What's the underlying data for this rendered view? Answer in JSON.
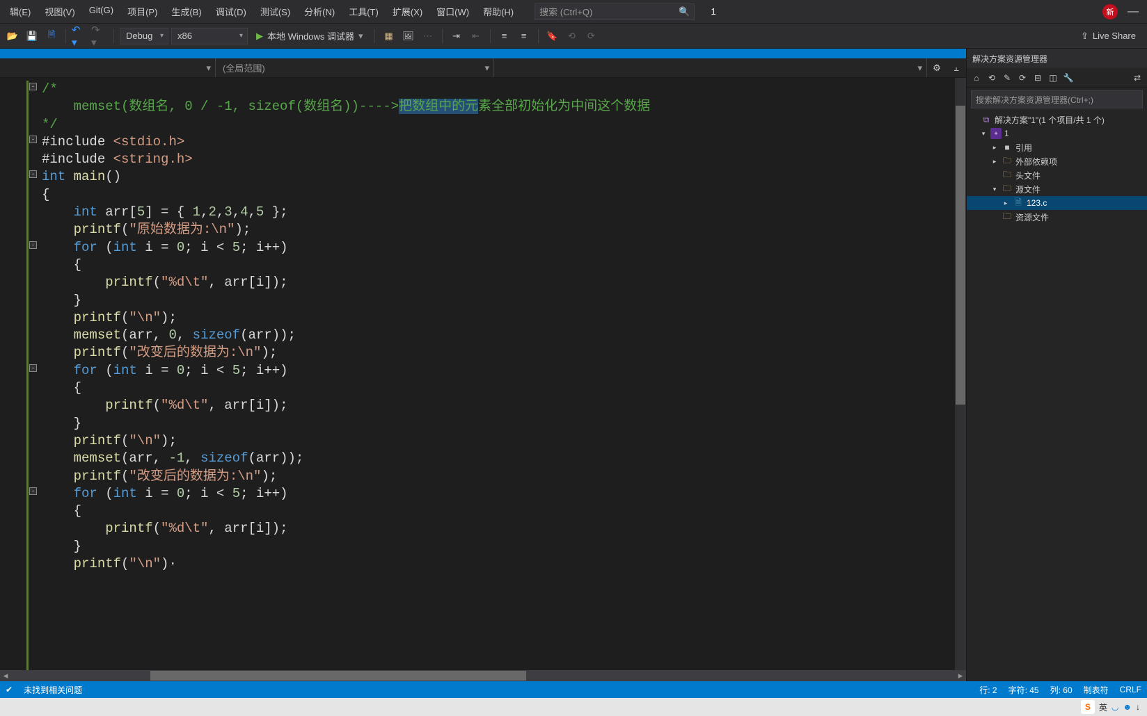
{
  "menubar": {
    "items": [
      "辑(E)",
      "视图(V)",
      "Git(G)",
      "项目(P)",
      "生成(B)",
      "调试(D)",
      "测试(S)",
      "分析(N)",
      "工具(T)",
      "扩展(X)",
      "窗口(W)",
      "帮助(H)"
    ],
    "search_placeholder": "搜索 (Ctrl+Q)",
    "tab_badge": "1",
    "new_badge": "新"
  },
  "toolbar": {
    "config": "Debug",
    "platform": "x86",
    "run_label": "本地 Windows 调试器",
    "live_share": "Live Share"
  },
  "editor": {
    "scope_combo": "(全局范围)",
    "code_lines": [
      {
        "indent": 0,
        "fold": "-",
        "tokens": [
          {
            "t": "c-comment",
            "v": "/*"
          }
        ]
      },
      {
        "indent": 2,
        "tokens": [
          {
            "t": "c-comment",
            "v": "memset(数组名, 0 / -1, sizeof(数组名))---->"
          },
          {
            "t": "c-comment sel-highlight",
            "v": "把数组中的元"
          },
          {
            "t": "c-comment",
            "v": "素全部初始化为中间这个数据"
          }
        ]
      },
      {
        "indent": 0,
        "tokens": [
          {
            "t": "c-comment",
            "v": "*/"
          }
        ]
      },
      {
        "indent": 0,
        "fold": "-",
        "tokens": [
          {
            "t": "c-default",
            "v": "#include "
          },
          {
            "t": "c-string",
            "v": "<stdio.h>"
          }
        ]
      },
      {
        "indent": 0,
        "tokens": [
          {
            "t": "c-default",
            "v": "#include "
          },
          {
            "t": "c-string",
            "v": "<string.h>"
          }
        ]
      },
      {
        "indent": 0,
        "fold": "-",
        "tokens": [
          {
            "t": "c-keyword",
            "v": "int"
          },
          {
            "t": "c-default",
            "v": " "
          },
          {
            "t": "c-func",
            "v": "main"
          },
          {
            "t": "c-default",
            "v": "()"
          }
        ]
      },
      {
        "indent": 0,
        "tokens": [
          {
            "t": "c-default",
            "v": "{"
          }
        ]
      },
      {
        "indent": 2,
        "tokens": [
          {
            "t": "c-keyword",
            "v": "int"
          },
          {
            "t": "c-default",
            "v": " arr["
          },
          {
            "t": "c-number",
            "v": "5"
          },
          {
            "t": "c-default",
            "v": "] = { "
          },
          {
            "t": "c-number",
            "v": "1"
          },
          {
            "t": "c-default",
            "v": ","
          },
          {
            "t": "c-number",
            "v": "2"
          },
          {
            "t": "c-default",
            "v": ","
          },
          {
            "t": "c-number",
            "v": "3"
          },
          {
            "t": "c-default",
            "v": ","
          },
          {
            "t": "c-number",
            "v": "4"
          },
          {
            "t": "c-default",
            "v": ","
          },
          {
            "t": "c-number",
            "v": "5"
          },
          {
            "t": "c-default",
            "v": " };"
          }
        ]
      },
      {
        "indent": 2,
        "tokens": [
          {
            "t": "c-func",
            "v": "printf"
          },
          {
            "t": "c-default",
            "v": "("
          },
          {
            "t": "c-string",
            "v": "\"原始数据为:\\n\""
          },
          {
            "t": "c-default",
            "v": ");"
          }
        ]
      },
      {
        "indent": 2,
        "fold": "-",
        "tokens": [
          {
            "t": "c-keyword",
            "v": "for"
          },
          {
            "t": "c-default",
            "v": " ("
          },
          {
            "t": "c-keyword",
            "v": "int"
          },
          {
            "t": "c-default",
            "v": " i = "
          },
          {
            "t": "c-number",
            "v": "0"
          },
          {
            "t": "c-default",
            "v": "; i < "
          },
          {
            "t": "c-number",
            "v": "5"
          },
          {
            "t": "c-default",
            "v": "; i++)"
          }
        ]
      },
      {
        "indent": 2,
        "tokens": [
          {
            "t": "c-default",
            "v": "{"
          }
        ]
      },
      {
        "indent": 4,
        "tokens": [
          {
            "t": "c-func",
            "v": "printf"
          },
          {
            "t": "c-default",
            "v": "("
          },
          {
            "t": "c-string",
            "v": "\"%d\\t\""
          },
          {
            "t": "c-default",
            "v": ", arr[i]);"
          }
        ]
      },
      {
        "indent": 2,
        "tokens": [
          {
            "t": "c-default",
            "v": "}"
          }
        ]
      },
      {
        "indent": 2,
        "tokens": [
          {
            "t": "c-func",
            "v": "printf"
          },
          {
            "t": "c-default",
            "v": "("
          },
          {
            "t": "c-string",
            "v": "\"\\n\""
          },
          {
            "t": "c-default",
            "v": ");"
          }
        ]
      },
      {
        "indent": 2,
        "tokens": [
          {
            "t": "c-func",
            "v": "memset"
          },
          {
            "t": "c-default",
            "v": "(arr, "
          },
          {
            "t": "c-number",
            "v": "0"
          },
          {
            "t": "c-default",
            "v": ", "
          },
          {
            "t": "c-keyword",
            "v": "sizeof"
          },
          {
            "t": "c-default",
            "v": "(arr));"
          }
        ]
      },
      {
        "indent": 2,
        "tokens": [
          {
            "t": "c-func",
            "v": "printf"
          },
          {
            "t": "c-default",
            "v": "("
          },
          {
            "t": "c-string",
            "v": "\"改变后的数据为:\\n\""
          },
          {
            "t": "c-default",
            "v": ");"
          }
        ]
      },
      {
        "indent": 2,
        "fold": "-",
        "tokens": [
          {
            "t": "c-keyword",
            "v": "for"
          },
          {
            "t": "c-default",
            "v": " ("
          },
          {
            "t": "c-keyword",
            "v": "int"
          },
          {
            "t": "c-default",
            "v": " i = "
          },
          {
            "t": "c-number",
            "v": "0"
          },
          {
            "t": "c-default",
            "v": "; i < "
          },
          {
            "t": "c-number",
            "v": "5"
          },
          {
            "t": "c-default",
            "v": "; i++)"
          }
        ]
      },
      {
        "indent": 2,
        "tokens": [
          {
            "t": "c-default",
            "v": "{"
          }
        ]
      },
      {
        "indent": 4,
        "tokens": [
          {
            "t": "c-func",
            "v": "printf"
          },
          {
            "t": "c-default",
            "v": "("
          },
          {
            "t": "c-string",
            "v": "\"%d\\t\""
          },
          {
            "t": "c-default",
            "v": ", arr[i]);"
          }
        ]
      },
      {
        "indent": 2,
        "tokens": [
          {
            "t": "c-default",
            "v": "}"
          }
        ]
      },
      {
        "indent": 2,
        "tokens": [
          {
            "t": "c-func",
            "v": "printf"
          },
          {
            "t": "c-default",
            "v": "("
          },
          {
            "t": "c-string",
            "v": "\"\\n\""
          },
          {
            "t": "c-default",
            "v": ");"
          }
        ]
      },
      {
        "indent": 2,
        "tokens": [
          {
            "t": "c-func",
            "v": "memset"
          },
          {
            "t": "c-default",
            "v": "(arr, "
          },
          {
            "t": "c-number",
            "v": "-1"
          },
          {
            "t": "c-default",
            "v": ", "
          },
          {
            "t": "c-keyword",
            "v": "sizeof"
          },
          {
            "t": "c-default",
            "v": "(arr));"
          }
        ]
      },
      {
        "indent": 2,
        "tokens": [
          {
            "t": "c-func",
            "v": "printf"
          },
          {
            "t": "c-default",
            "v": "("
          },
          {
            "t": "c-string",
            "v": "\"改变后的数据为:\\n\""
          },
          {
            "t": "c-default",
            "v": ");"
          }
        ]
      },
      {
        "indent": 2,
        "fold": "-",
        "tokens": [
          {
            "t": "c-keyword",
            "v": "for"
          },
          {
            "t": "c-default",
            "v": " ("
          },
          {
            "t": "c-keyword",
            "v": "int"
          },
          {
            "t": "c-default",
            "v": " i = "
          },
          {
            "t": "c-number",
            "v": "0"
          },
          {
            "t": "c-default",
            "v": "; i < "
          },
          {
            "t": "c-number",
            "v": "5"
          },
          {
            "t": "c-default",
            "v": "; i++)"
          }
        ]
      },
      {
        "indent": 2,
        "tokens": [
          {
            "t": "c-default",
            "v": "{"
          }
        ]
      },
      {
        "indent": 4,
        "tokens": [
          {
            "t": "c-func",
            "v": "printf"
          },
          {
            "t": "c-default",
            "v": "("
          },
          {
            "t": "c-string",
            "v": "\"%d\\t\""
          },
          {
            "t": "c-default",
            "v": ", arr[i]);"
          }
        ]
      },
      {
        "indent": 2,
        "tokens": [
          {
            "t": "c-default",
            "v": "}"
          }
        ]
      },
      {
        "indent": 2,
        "tokens": [
          {
            "t": "c-func",
            "v": "printf"
          },
          {
            "t": "c-default",
            "v": "("
          },
          {
            "t": "c-string",
            "v": "\"\\n\""
          },
          {
            "t": "c-default",
            "v": ")·"
          }
        ]
      }
    ]
  },
  "solution_explorer": {
    "title": "解决方案资源管理器",
    "search_placeholder": "搜索解决方案资源管理器(Ctrl+;)",
    "tree": [
      {
        "level": 0,
        "exp": "",
        "icon": "sln",
        "label": "解决方案\"1\"(1 个项目/共 1 个)"
      },
      {
        "level": 1,
        "exp": "▾",
        "icon": "proj",
        "label": "1"
      },
      {
        "level": 2,
        "exp": "▸",
        "icon": "ref",
        "label": "引用"
      },
      {
        "level": 2,
        "exp": "▸",
        "icon": "folder",
        "label": "外部依赖项"
      },
      {
        "level": 2,
        "exp": "",
        "icon": "folder",
        "label": "头文件"
      },
      {
        "level": 2,
        "exp": "▾",
        "icon": "folder",
        "label": "源文件"
      },
      {
        "level": 3,
        "exp": "▸",
        "icon": "cfile",
        "label": "123.c",
        "active": true
      },
      {
        "level": 2,
        "exp": "",
        "icon": "folder",
        "label": "资源文件"
      }
    ]
  },
  "statusbar": {
    "issues": "未找到相关问题",
    "line": "行: 2",
    "char": "字符: 45",
    "col": "列: 60",
    "tabs": "制表符",
    "eol": "CRLF"
  },
  "taskbar": {
    "ime": "英",
    "sogou": "S"
  }
}
